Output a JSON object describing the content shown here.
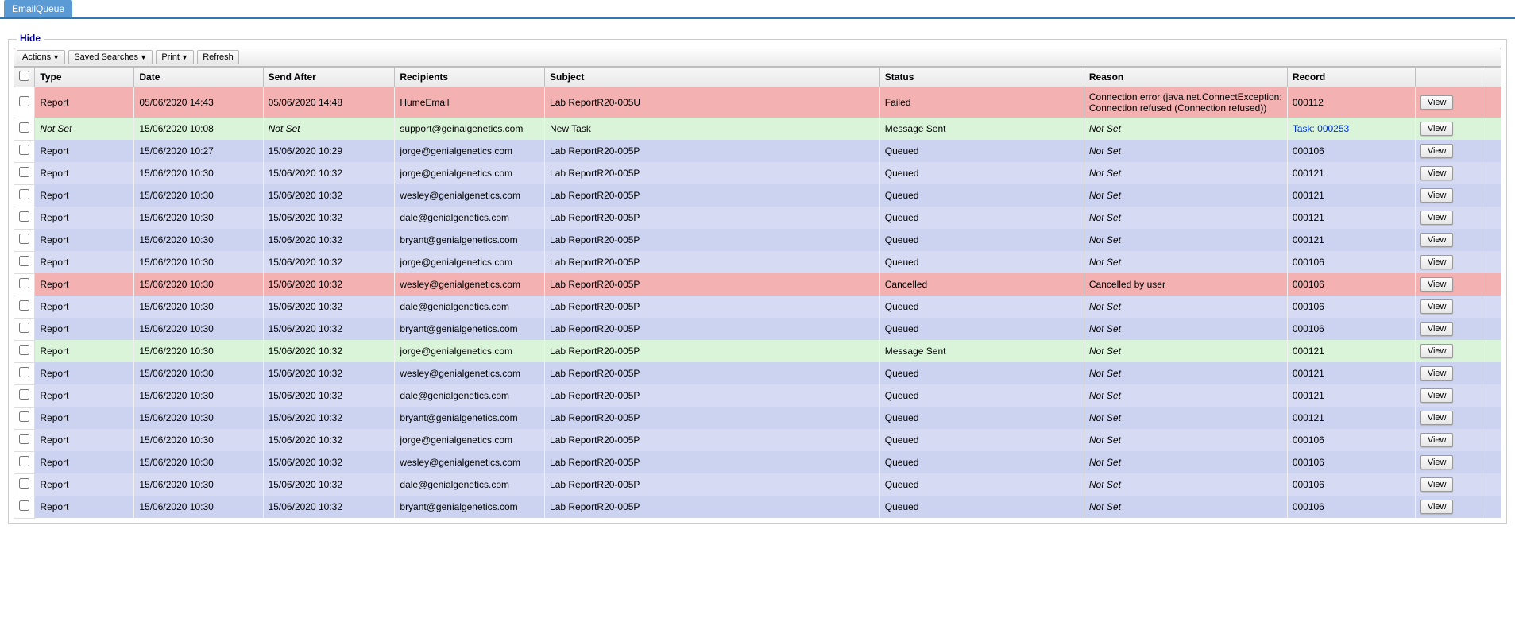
{
  "tab": {
    "label": "EmailQueue"
  },
  "panel": {
    "label": "Hide"
  },
  "toolbar": {
    "actions": "Actions",
    "savedSearches": "Saved Searches",
    "print": "Print",
    "refresh": "Refresh"
  },
  "columns": {
    "type": "Type",
    "date": "Date",
    "sendAfter": "Send After",
    "recipients": "Recipients",
    "subject": "Subject",
    "status": "Status",
    "reason": "Reason",
    "record": "Record"
  },
  "viewLabel": "View",
  "rows": [
    {
      "rowClass": "failed",
      "type": "Report",
      "date": "05/06/2020 14:43",
      "sendAfter": "05/06/2020 14:48",
      "recipients": "HumeEmail",
      "subject": "Lab ReportR20-005U",
      "status": "Failed",
      "reason": "Connection error (java.net.ConnectException: Connection refused (Connection refused))",
      "record": "000112",
      "recordLink": false,
      "italicType": false,
      "italicSendAfter": false,
      "italicReason": false
    },
    {
      "rowClass": "sent",
      "type": "Not Set",
      "date": "15/06/2020 10:08",
      "sendAfter": "Not Set",
      "recipients": "support@geinalgenetics.com",
      "subject": "New Task",
      "status": "Message Sent",
      "reason": "Not Set",
      "record": "Task: 000253",
      "recordLink": true,
      "italicType": true,
      "italicSendAfter": true,
      "italicReason": true
    },
    {
      "rowClass": "queued-a",
      "type": "Report",
      "date": "15/06/2020 10:27",
      "sendAfter": "15/06/2020 10:29",
      "recipients": "jorge@genialgenetics.com",
      "subject": "Lab ReportR20-005P",
      "status": "Queued",
      "reason": "Not Set",
      "record": "000106",
      "recordLink": false,
      "italicType": false,
      "italicSendAfter": false,
      "italicReason": true
    },
    {
      "rowClass": "queued-b",
      "type": "Report",
      "date": "15/06/2020 10:30",
      "sendAfter": "15/06/2020 10:32",
      "recipients": "jorge@genialgenetics.com",
      "subject": "Lab ReportR20-005P",
      "status": "Queued",
      "reason": "Not Set",
      "record": "000121",
      "recordLink": false,
      "italicType": false,
      "italicSendAfter": false,
      "italicReason": true
    },
    {
      "rowClass": "queued-a",
      "type": "Report",
      "date": "15/06/2020 10:30",
      "sendAfter": "15/06/2020 10:32",
      "recipients": "wesley@genialgenetics.com",
      "subject": "Lab ReportR20-005P",
      "status": "Queued",
      "reason": "Not Set",
      "record": "000121",
      "recordLink": false,
      "italicType": false,
      "italicSendAfter": false,
      "italicReason": true
    },
    {
      "rowClass": "queued-b",
      "type": "Report",
      "date": "15/06/2020 10:30",
      "sendAfter": "15/06/2020 10:32",
      "recipients": "dale@genialgenetics.com",
      "subject": "Lab ReportR20-005P",
      "status": "Queued",
      "reason": "Not Set",
      "record": "000121",
      "recordLink": false,
      "italicType": false,
      "italicSendAfter": false,
      "italicReason": true
    },
    {
      "rowClass": "queued-a",
      "type": "Report",
      "date": "15/06/2020 10:30",
      "sendAfter": "15/06/2020 10:32",
      "recipients": "bryant@genialgenetics.com",
      "subject": "Lab ReportR20-005P",
      "status": "Queued",
      "reason": "Not Set",
      "record": "000121",
      "recordLink": false,
      "italicType": false,
      "italicSendAfter": false,
      "italicReason": true
    },
    {
      "rowClass": "queued-b",
      "type": "Report",
      "date": "15/06/2020 10:30",
      "sendAfter": "15/06/2020 10:32",
      "recipients": "jorge@genialgenetics.com",
      "subject": "Lab ReportR20-005P",
      "status": "Queued",
      "reason": "Not Set",
      "record": "000106",
      "recordLink": false,
      "italicType": false,
      "italicSendAfter": false,
      "italicReason": true
    },
    {
      "rowClass": "cancelled",
      "type": "Report",
      "date": "15/06/2020 10:30",
      "sendAfter": "15/06/2020 10:32",
      "recipients": "wesley@genialgenetics.com",
      "subject": "Lab ReportR20-005P",
      "status": "Cancelled",
      "reason": "Cancelled by user",
      "record": "000106",
      "recordLink": false,
      "italicType": false,
      "italicSendAfter": false,
      "italicReason": false
    },
    {
      "rowClass": "queued-b",
      "type": "Report",
      "date": "15/06/2020 10:30",
      "sendAfter": "15/06/2020 10:32",
      "recipients": "dale@genialgenetics.com",
      "subject": "Lab ReportR20-005P",
      "status": "Queued",
      "reason": "Not Set",
      "record": "000106",
      "recordLink": false,
      "italicType": false,
      "italicSendAfter": false,
      "italicReason": true
    },
    {
      "rowClass": "queued-a",
      "type": "Report",
      "date": "15/06/2020 10:30",
      "sendAfter": "15/06/2020 10:32",
      "recipients": "bryant@genialgenetics.com",
      "subject": "Lab ReportR20-005P",
      "status": "Queued",
      "reason": "Not Set",
      "record": "000106",
      "recordLink": false,
      "italicType": false,
      "italicSendAfter": false,
      "italicReason": true
    },
    {
      "rowClass": "sent",
      "type": "Report",
      "date": "15/06/2020 10:30",
      "sendAfter": "15/06/2020 10:32",
      "recipients": "jorge@genialgenetics.com",
      "subject": "Lab ReportR20-005P",
      "status": "Message Sent",
      "reason": "Not Set",
      "record": "000121",
      "recordLink": false,
      "italicType": false,
      "italicSendAfter": false,
      "italicReason": true
    },
    {
      "rowClass": "queued-a",
      "type": "Report",
      "date": "15/06/2020 10:30",
      "sendAfter": "15/06/2020 10:32",
      "recipients": "wesley@genialgenetics.com",
      "subject": "Lab ReportR20-005P",
      "status": "Queued",
      "reason": "Not Set",
      "record": "000121",
      "recordLink": false,
      "italicType": false,
      "italicSendAfter": false,
      "italicReason": true
    },
    {
      "rowClass": "queued-b",
      "type": "Report",
      "date": "15/06/2020 10:30",
      "sendAfter": "15/06/2020 10:32",
      "recipients": "dale@genialgenetics.com",
      "subject": "Lab ReportR20-005P",
      "status": "Queued",
      "reason": "Not Set",
      "record": "000121",
      "recordLink": false,
      "italicType": false,
      "italicSendAfter": false,
      "italicReason": true
    },
    {
      "rowClass": "queued-a",
      "type": "Report",
      "date": "15/06/2020 10:30",
      "sendAfter": "15/06/2020 10:32",
      "recipients": "bryant@genialgenetics.com",
      "subject": "Lab ReportR20-005P",
      "status": "Queued",
      "reason": "Not Set",
      "record": "000121",
      "recordLink": false,
      "italicType": false,
      "italicSendAfter": false,
      "italicReason": true
    },
    {
      "rowClass": "queued-b",
      "type": "Report",
      "date": "15/06/2020 10:30",
      "sendAfter": "15/06/2020 10:32",
      "recipients": "jorge@genialgenetics.com",
      "subject": "Lab ReportR20-005P",
      "status": "Queued",
      "reason": "Not Set",
      "record": "000106",
      "recordLink": false,
      "italicType": false,
      "italicSendAfter": false,
      "italicReason": true
    },
    {
      "rowClass": "queued-a",
      "type": "Report",
      "date": "15/06/2020 10:30",
      "sendAfter": "15/06/2020 10:32",
      "recipients": "wesley@genialgenetics.com",
      "subject": "Lab ReportR20-005P",
      "status": "Queued",
      "reason": "Not Set",
      "record": "000106",
      "recordLink": false,
      "italicType": false,
      "italicSendAfter": false,
      "italicReason": true
    },
    {
      "rowClass": "queued-b",
      "type": "Report",
      "date": "15/06/2020 10:30",
      "sendAfter": "15/06/2020 10:32",
      "recipients": "dale@genialgenetics.com",
      "subject": "Lab ReportR20-005P",
      "status": "Queued",
      "reason": "Not Set",
      "record": "000106",
      "recordLink": false,
      "italicType": false,
      "italicSendAfter": false,
      "italicReason": true
    },
    {
      "rowClass": "queued-a",
      "type": "Report",
      "date": "15/06/2020 10:30",
      "sendAfter": "15/06/2020 10:32",
      "recipients": "bryant@genialgenetics.com",
      "subject": "Lab ReportR20-005P",
      "status": "Queued",
      "reason": "Not Set",
      "record": "000106",
      "recordLink": false,
      "italicType": false,
      "italicSendAfter": false,
      "italicReason": true
    }
  ]
}
